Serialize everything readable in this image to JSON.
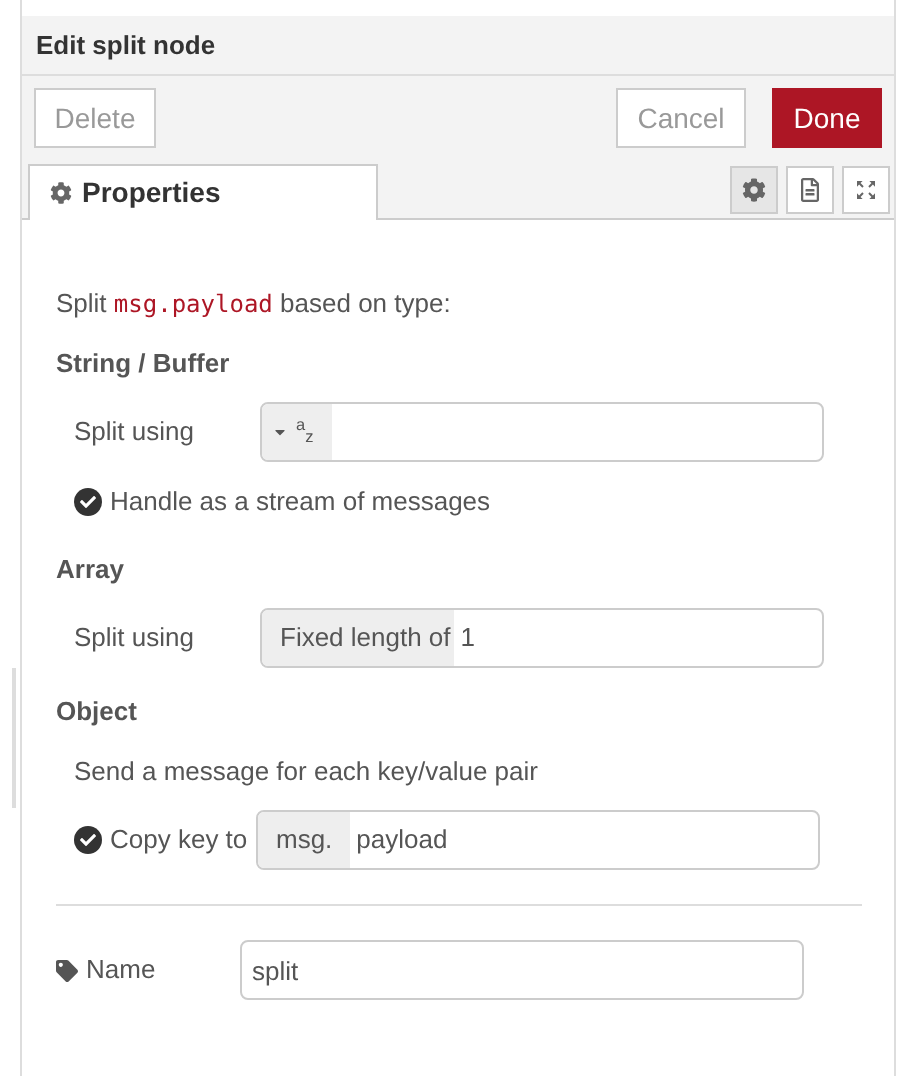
{
  "title": "Edit split node",
  "buttons": {
    "delete": "Delete",
    "cancel": "Cancel",
    "done": "Done"
  },
  "tabs": [
    {
      "label": "Properties",
      "selected": true
    }
  ],
  "tab_icons": [
    {
      "kind": "gear",
      "selected": true
    },
    {
      "kind": "document",
      "selected": false
    },
    {
      "kind": "frame",
      "selected": false
    }
  ],
  "intro": {
    "before": "Split",
    "code": "msg.payload",
    "after": "based on type:"
  },
  "string_section": {
    "heading": "String / Buffer",
    "label": "Split using",
    "type_glyph": "$^{a}$$_{z}$",
    "stream": {
      "label": "Handle as a stream of messages",
      "checked": true
    }
  },
  "array_section": {
    "heading": "Array",
    "label": "Split using",
    "prefix": "Fixed length of",
    "value": "1"
  },
  "object_section": {
    "heading": "Object",
    "note": "Send a message for each key/value pair",
    "copy": {
      "label": "Copy key to",
      "checked": true
    },
    "prefix": "msg.",
    "value": "payload"
  },
  "name_field": {
    "label": "Name",
    "value": "split"
  }
}
